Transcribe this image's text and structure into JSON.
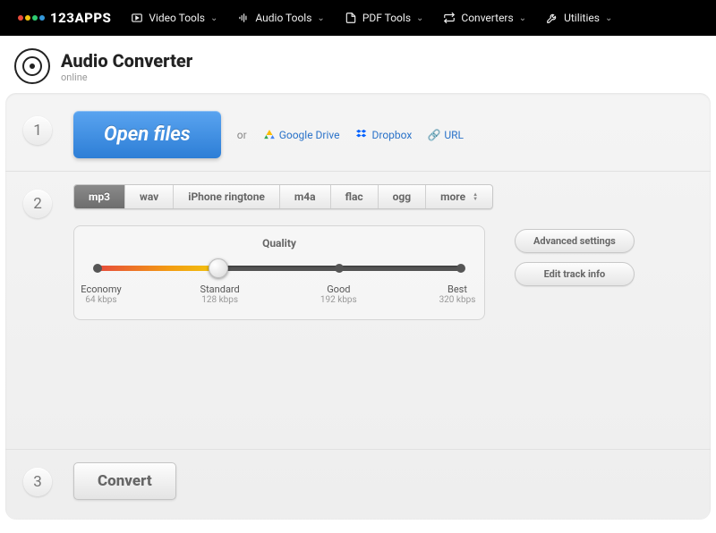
{
  "brand": "123APPS",
  "brand_colors": [
    "#e74c3c",
    "#f1c40f",
    "#2ecc71",
    "#3498db"
  ],
  "nav": [
    {
      "label": "Video Tools",
      "icon": "play"
    },
    {
      "label": "Audio Tools",
      "icon": "audio"
    },
    {
      "label": "PDF Tools",
      "icon": "pdf"
    },
    {
      "label": "Converters",
      "icon": "convert"
    },
    {
      "label": "Utilities",
      "icon": "util"
    }
  ],
  "app": {
    "title": "Audio Converter",
    "subtitle": "online"
  },
  "step1": {
    "open_label": "Open files",
    "or": "or",
    "sources": [
      {
        "label": "Google Drive",
        "icon": "gdrive",
        "color": "#fbbc04"
      },
      {
        "label": "Dropbox",
        "icon": "dropbox",
        "color": "#0061ff"
      },
      {
        "label": "URL",
        "icon": "link",
        "color": "#888"
      }
    ]
  },
  "step2": {
    "formats": [
      "mp3",
      "wav",
      "iPhone ringtone",
      "m4a",
      "flac",
      "ogg",
      "more"
    ],
    "active_format": 0,
    "quality_title": "Quality",
    "levels": [
      {
        "name": "Economy",
        "rate": "64 kbps"
      },
      {
        "name": "Standard",
        "rate": "128 kbps"
      },
      {
        "name": "Good",
        "rate": "192 kbps"
      },
      {
        "name": "Best",
        "rate": "320 kbps"
      }
    ],
    "selected_level": 1,
    "adv_label": "Advanced settings",
    "edit_label": "Edit track info"
  },
  "step3": {
    "convert_label": "Convert"
  }
}
